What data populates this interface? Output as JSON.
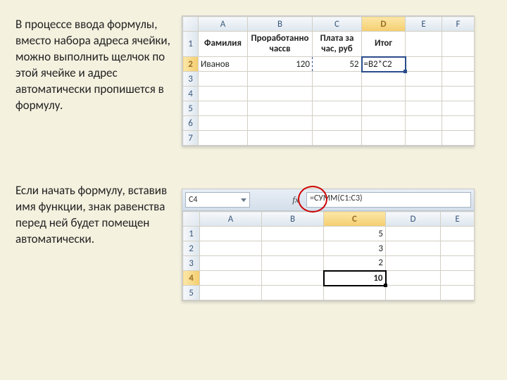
{
  "text": {
    "para1": "В процессе ввода формулы, вместо набора адреса ячейки, можно выполнить щелчок по этой ячейке и адрес автоматически пропишется в формулу.",
    "para2": "Если начать формулу, вставив имя функции, знак равенства перед ней будет помещен автоматически."
  },
  "sheet1": {
    "columns": [
      "A",
      "B",
      "C",
      "D",
      "E",
      "F"
    ],
    "rows": [
      "1",
      "2",
      "3",
      "4",
      "5",
      "6",
      "7"
    ],
    "selected_row": "2",
    "selected_col": "D",
    "headers": {
      "A": "Фамилия",
      "B": "Проработанно чассв",
      "C": "Плата за час, руб",
      "D": "Итог"
    },
    "row2": {
      "A": "Иванов",
      "B": "120",
      "C": "52",
      "D": "=B2*C2"
    }
  },
  "sheet2": {
    "namebox": "C4",
    "fx_label": "fx",
    "formula": "=СУММ(C1:C3)",
    "columns": [
      "A",
      "B",
      "C",
      "D",
      "E"
    ],
    "rows": [
      "1",
      "2",
      "3",
      "4",
      "5"
    ],
    "selected_row": "4",
    "selected_col": "C",
    "col_c": {
      "1": "5",
      "2": "3",
      "3": "2",
      "4": "10"
    }
  },
  "chart_data": null
}
